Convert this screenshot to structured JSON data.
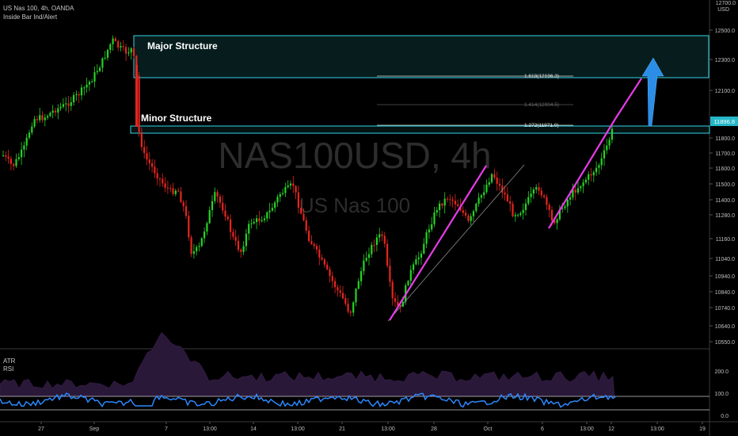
{
  "header": {
    "symbol_line": "US Nas 100, 4h, OANDA",
    "indicator_line": "Inside Bar Ind/Alert"
  },
  "watermark": {
    "main": "NAS100USD, 4h",
    "sub": "US Nas 100"
  },
  "price_axis": {
    "top_partial": "12700.0",
    "currency": "USD",
    "ticks": [
      "12500.0",
      "12300.0",
      "12100.0",
      "11800.0",
      "11700.0",
      "11600.0",
      "11500.0",
      "11400.0",
      "11280.0",
      "11160.0",
      "11040.0",
      "10940.0",
      "10840.0",
      "10740.0",
      "10640.0",
      "10550.0"
    ],
    "last_price": "11896.8"
  },
  "rsi_axis": {
    "ticks": [
      "200.0",
      "100.0",
      "0.0"
    ]
  },
  "time_axis": {
    "labels": [
      "27",
      "Sep",
      "7",
      "13:00",
      "14",
      "13:00",
      "21",
      "13:00",
      "28",
      "Oct",
      "6",
      "13:00",
      "12",
      "13:00",
      "19"
    ]
  },
  "annotations": {
    "major_label": "Major Structure",
    "minor_label": "Minor Structure",
    "fib": [
      "1.618(12196.3)",
      "1.414(12004.5)",
      "1.272(11871.0)"
    ]
  },
  "indicators": {
    "atr": "ATR",
    "rsi": "RSI"
  },
  "colors": {
    "up": "#26d326",
    "down": "#e5261f",
    "zone": "#33d6e6",
    "trend": "#e83ce8",
    "arrow": "#2b8de6",
    "rsi": "#2b88ff",
    "atr_fill": "#2a1838",
    "last_price_bg": "#24b7c8"
  },
  "chart_data": {
    "type": "candlestick",
    "approx_close_path": [
      {
        "t": "Aug 25",
        "p": 11600
      },
      {
        "t": "Aug 27",
        "p": 11900
      },
      {
        "t": "Aug 30",
        "p": 12150
      },
      {
        "t": "Sep 2",
        "p": 12460
      },
      {
        "t": "Sep 3",
        "p": 12150
      },
      {
        "t": "Sep 4",
        "p": 11700
      },
      {
        "t": "Sep 8",
        "p": 11450
      },
      {
        "t": "Sep 10",
        "p": 11000
      },
      {
        "t": "Sep 14",
        "p": 11220
      },
      {
        "t": "Sep 17",
        "p": 11480
      },
      {
        "t": "Sep 21",
        "p": 10700
      },
      {
        "t": "Sep 23",
        "p": 11200
      },
      {
        "t": "Sep 24",
        "p": 10710
      },
      {
        "t": "Sep 28",
        "p": 11400
      },
      {
        "t": "Oct 2",
        "p": 11620
      },
      {
        "t": "Oct 5",
        "p": 11450
      },
      {
        "t": "Oct 7",
        "p": 11480
      },
      {
        "t": "Oct 8",
        "p": 11250
      },
      {
        "t": "Oct 12",
        "p": 11890
      }
    ],
    "zones": [
      {
        "name": "Major Structure",
        "low": 12196.3,
        "high": 12480
      },
      {
        "name": "Minor Structure",
        "low": 11800,
        "high": 11871
      }
    ],
    "fib_levels": [
      1.618,
      1.414,
      1.272
    ],
    "rsi_range": [
      0,
      200
    ]
  }
}
